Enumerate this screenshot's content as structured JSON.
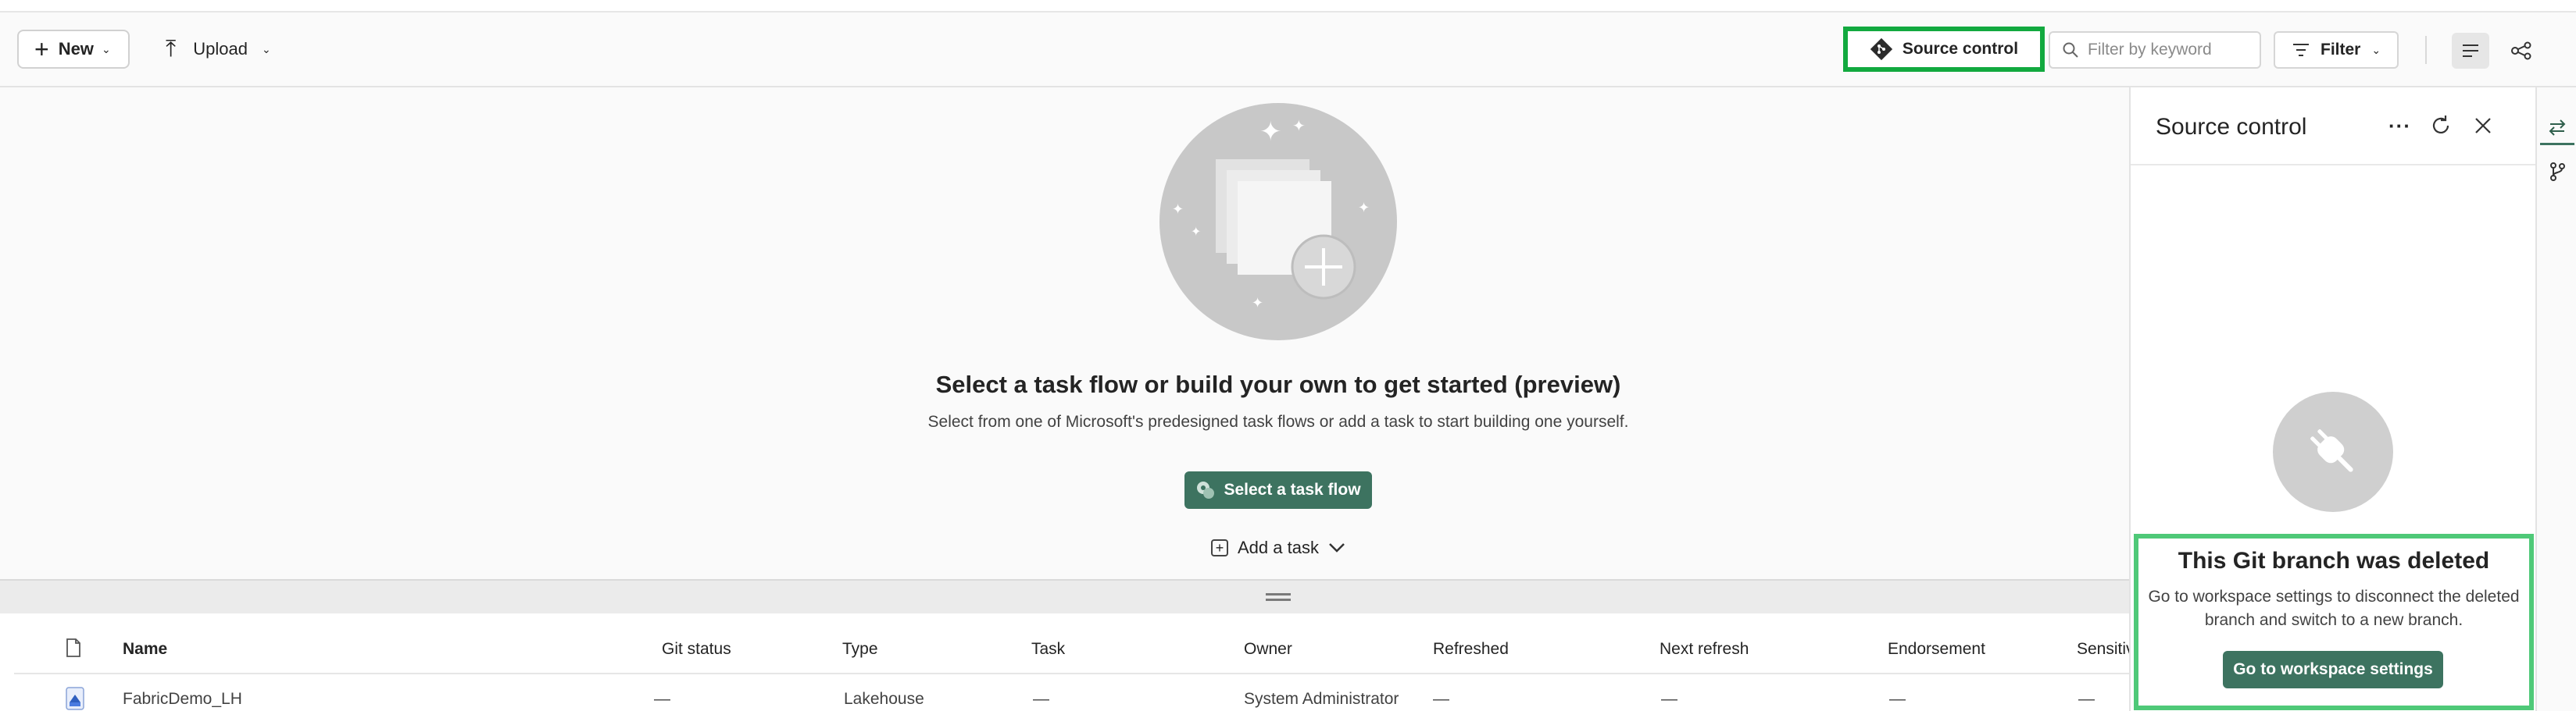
{
  "toolbar": {
    "new_label": "New",
    "upload_label": "Upload",
    "source_control_label": "Source control",
    "filter_placeholder": "Filter by keyword",
    "filter_label": "Filter"
  },
  "empty_state": {
    "title": "Select a task flow or build your own to get started (preview)",
    "subtitle": "Select from one of Microsoft's predesigned task flows or add a task to start building one yourself.",
    "select_taskflow_label": "Select a task flow",
    "add_task_label": "Add a task"
  },
  "table": {
    "columns": [
      "Name",
      "Git status",
      "Type",
      "Task",
      "Owner",
      "Refreshed",
      "Next refresh",
      "Endorsement",
      "Sensitiv"
    ],
    "rows": [
      {
        "name": "FabricDemo_LH",
        "git_status": "—",
        "type": "Lakehouse",
        "task": "—",
        "owner": "System Administrator",
        "refreshed": "—",
        "next_refresh": "—",
        "endorsement": "—",
        "sensitivity": "—"
      }
    ]
  },
  "source_panel": {
    "title": "Source control",
    "more_label": "···",
    "deleted_title": "This Git branch was deleted",
    "deleted_text": "Go to workspace settings to disconnect the deleted branch and switch to a new branch.",
    "workspace_button_label": "Go to workspace settings"
  },
  "icons": {
    "new": "plus-icon",
    "upload": "upload-icon",
    "source_control": "git-icon",
    "search": "search-icon",
    "filter": "filter-icon",
    "list_view": "list-view-icon",
    "lineage_view": "lineage-icon",
    "refresh": "refresh-icon",
    "close": "close-icon",
    "plug": "plug-icon",
    "changes_tab": "swap-arrows-icon",
    "branches_tab": "branch-icon"
  },
  "colors": {
    "primary_button": "#3d7360",
    "highlight_border_dark": "#12a93f",
    "highlight_border_light": "#4fc978"
  }
}
